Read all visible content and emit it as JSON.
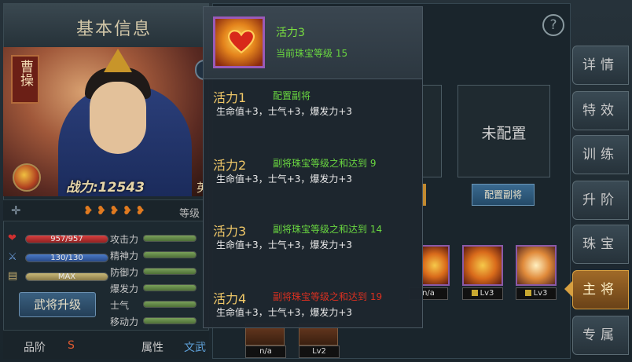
{
  "left": {
    "title": "基本信息",
    "hero_name": "曹操",
    "power": "战力:12543",
    "power_tail": "英",
    "level_label": "等级",
    "hp": "957/957",
    "mp": "130/130",
    "exp": "MAX",
    "stats": [
      "攻击力",
      "精神力",
      "防御力",
      "爆发力",
      "士气",
      "移动力"
    ],
    "upgrade_button": "武将升级",
    "grade_label": "品阶",
    "grade_value": "S",
    "attr_label": "属性",
    "attr_value": "文武"
  },
  "main": {
    "unassigned": "未配置",
    "assign_button": "配置副将",
    "gems": [
      {
        "label": "n/a"
      },
      {
        "label": "Lv3"
      },
      {
        "label": "Lv3"
      }
    ],
    "small_gems": [
      {
        "label": "n/a"
      },
      {
        "label": "Lv2"
      }
    ]
  },
  "side_menu": [
    "详情",
    "特效",
    "训练",
    "升阶",
    "珠宝",
    "主将",
    "专属"
  ],
  "popup": {
    "title": "活力3",
    "subtitle": "当前珠宝等级 15",
    "entries": [
      {
        "name": "活力1",
        "condition": "配置副将",
        "effect": "生命值+3，士气+3，爆发力+3",
        "met": true
      },
      {
        "name": "活力2",
        "condition": "副将珠宝等级之和达到 9",
        "effect": "生命值+3，士气+3，爆发力+3",
        "met": true
      },
      {
        "name": "活力3",
        "condition": "副将珠宝等级之和达到 14",
        "effect": "生命值+3，士气+3，爆发力+3",
        "met": true
      },
      {
        "name": "活力4",
        "condition": "副将珠宝等级之和达到 19",
        "effect": "生命值+3，士气+3，爆发力+3",
        "met": false
      }
    ]
  },
  "colors": {
    "accent_gold": "#f0c868",
    "condition_met": "#6ad840",
    "condition_locked": "#d83020",
    "hp_bar": "#c0302a",
    "mp_bar": "#3a6ab8",
    "exp_bar": "#b8a870"
  },
  "levels": {
    "hp_fraction": 1.0,
    "mp_fraction": 1.0,
    "exp_fraction": 1.0
  }
}
